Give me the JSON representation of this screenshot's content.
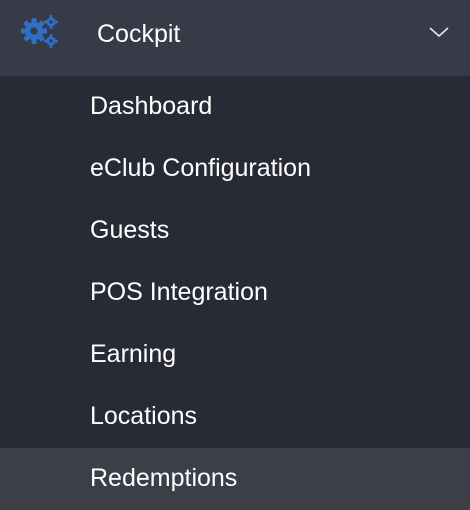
{
  "header": {
    "title": "Cockpit",
    "icon": "gears-icon",
    "expand_icon": "chevron-down-icon"
  },
  "submenu": {
    "items": [
      {
        "label": "Dashboard"
      },
      {
        "label": "eClub Configuration"
      },
      {
        "label": "Guests"
      },
      {
        "label": "POS Integration"
      },
      {
        "label": "Earning"
      },
      {
        "label": "Locations"
      },
      {
        "label": "Redemptions",
        "active": true
      }
    ]
  },
  "colors": {
    "header_bg": "#373a47",
    "menu_bg": "#282b36",
    "active_bg": "#3c3e48",
    "icon_accent": "#2f6fc4",
    "text": "#ffffff"
  }
}
